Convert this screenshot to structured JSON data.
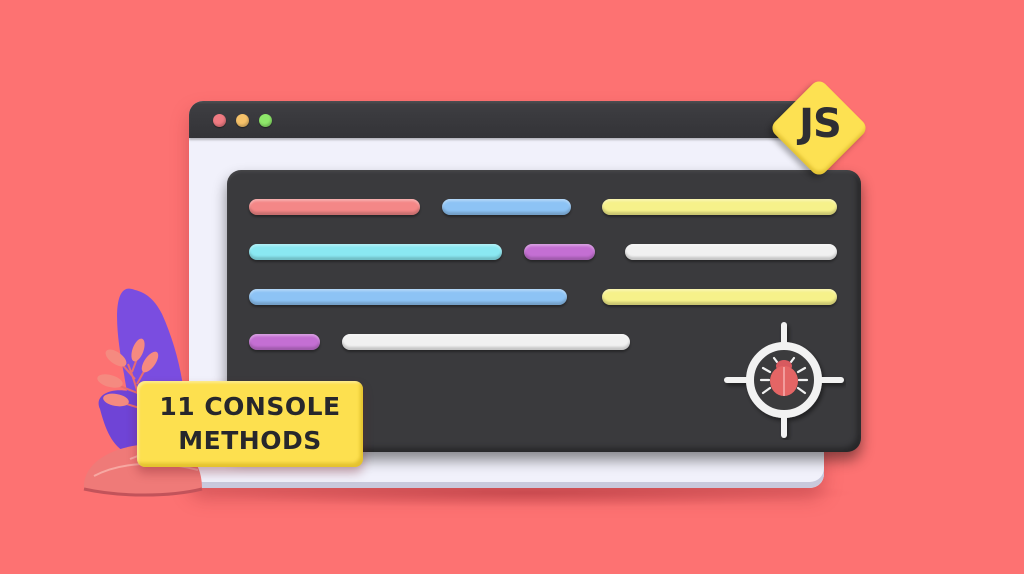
{
  "browser_window": {
    "traffic_lights": [
      {
        "name": "close",
        "color": "#f07b82"
      },
      {
        "name": "minimize",
        "color": "#f6c26a"
      },
      {
        "name": "maximize",
        "color": "#8ee86a"
      }
    ]
  },
  "console_panel": {
    "code_rows": [
      [
        {
          "color": "#f48787",
          "span": 0.29
        },
        {
          "color": "#8dc3f5",
          "span": 0.22
        },
        {
          "color": "#f6f18a",
          "span": 0.4
        }
      ],
      [
        {
          "color": "#8ae8f2",
          "span": 0.43
        },
        {
          "color": "#c46fd3",
          "span": 0.12
        },
        {
          "color": "#f1f1f1",
          "span": 0.36
        }
      ],
      [
        {
          "color": "#8dc3f5",
          "span": 0.54
        },
        {
          "color": "#f6f18a",
          "span": 0.4
        }
      ],
      [
        {
          "color": "#c46fd3",
          "span": 0.12
        },
        {
          "color": "#f1f1f1",
          "span": 0.49
        }
      ]
    ]
  },
  "badge": {
    "text": "JS",
    "color": "#fde152"
  },
  "debug_target": {
    "icon": "bug-icon",
    "bug_color": "#e46565"
  },
  "title_label": {
    "line1": "11 CONSOLE",
    "line2": "METHODS",
    "color": "#fde04f"
  },
  "colors": {
    "background": "#fd7272",
    "window_chrome": "#38383c",
    "console_bg": "#3a3a3d",
    "plant_leaf": "#7c4fe0",
    "plant_sprig": "#f58a80",
    "pot": "#f07a78"
  }
}
